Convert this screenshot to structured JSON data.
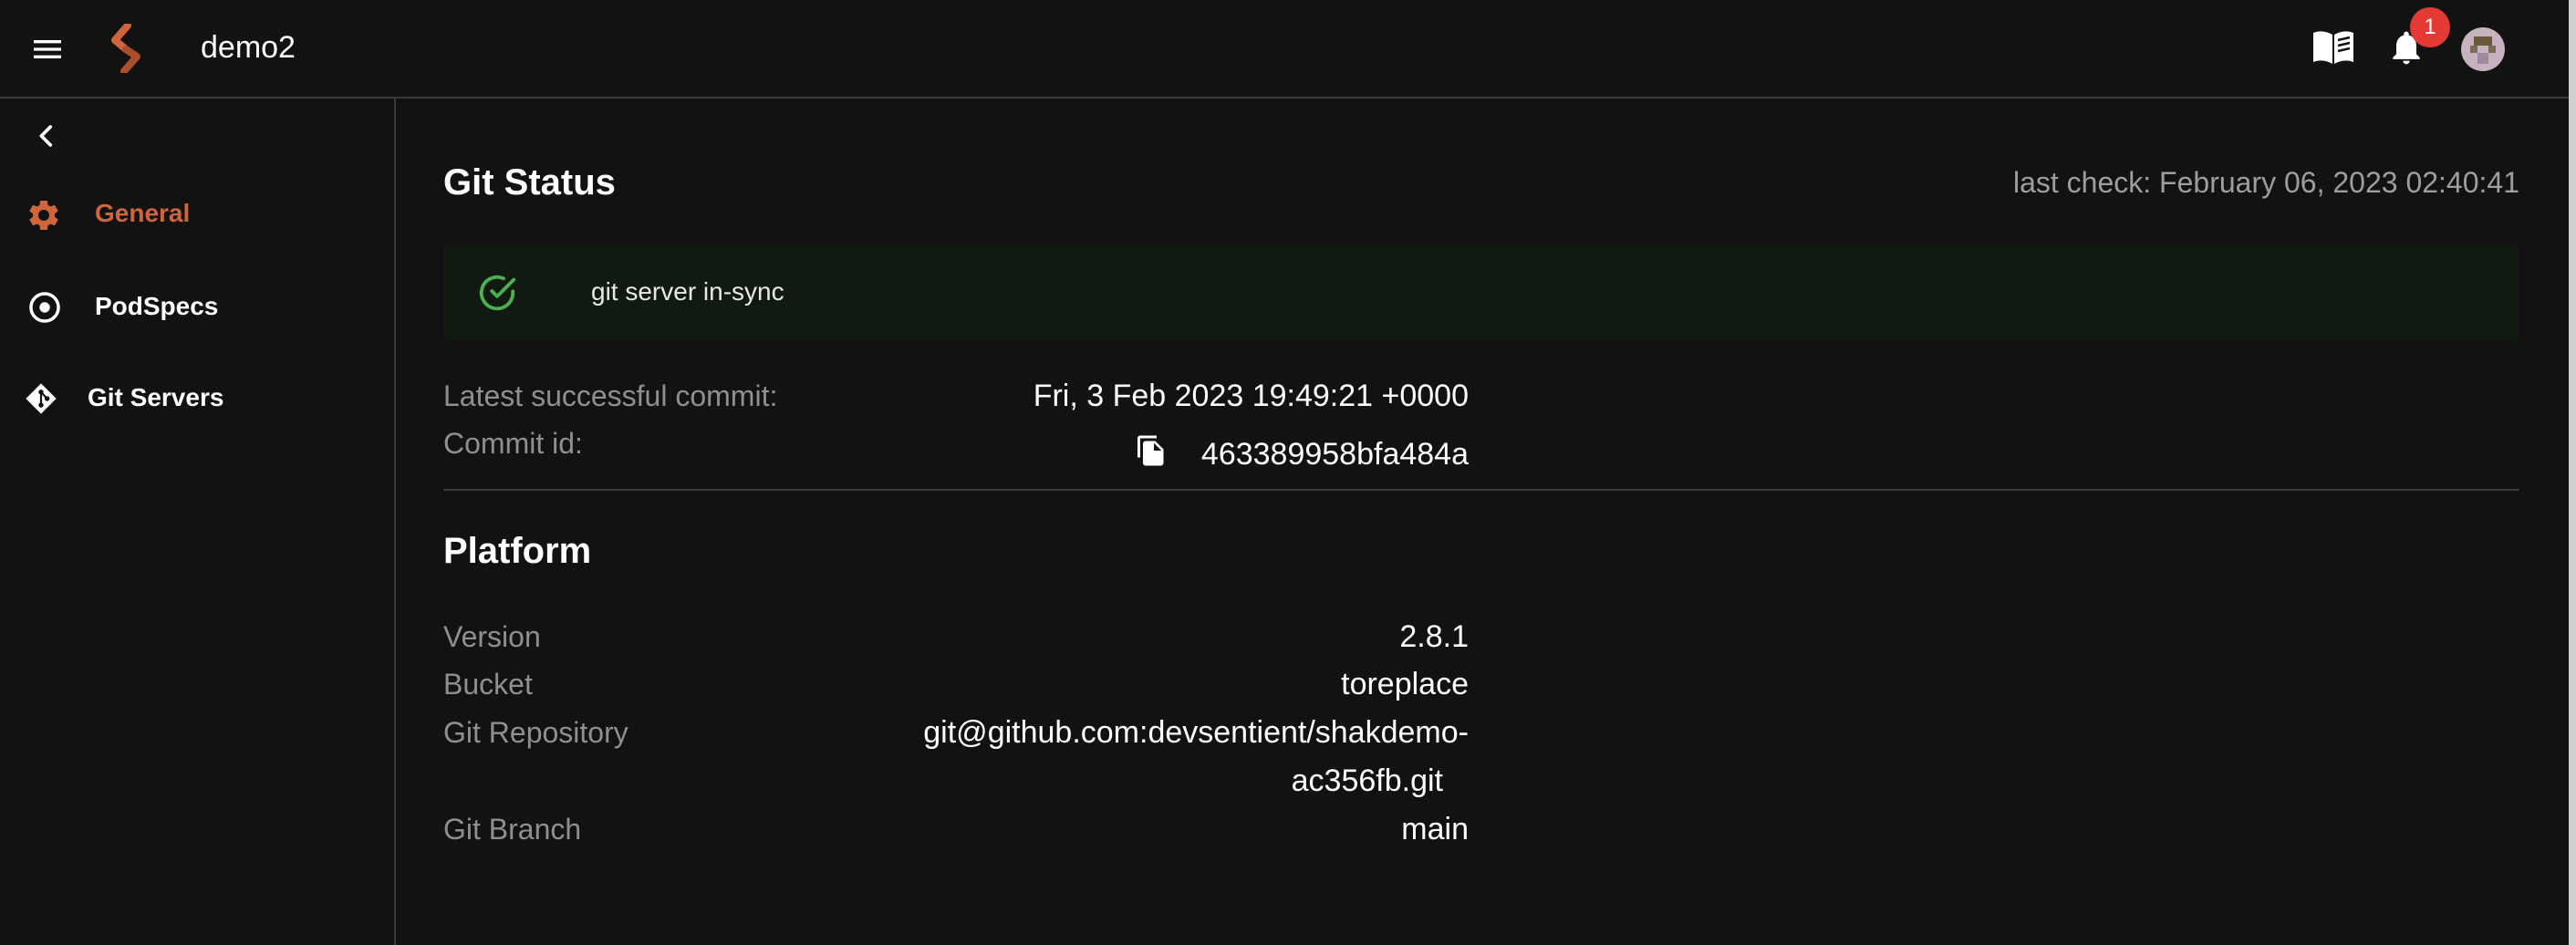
{
  "header": {
    "app_title": "demo2",
    "notifications_count": "1",
    "icons": [
      "menu-icon",
      "logo-icon",
      "docs-book-icon",
      "bell-icon",
      "avatar"
    ]
  },
  "sidebar": {
    "items": [
      {
        "label": "General",
        "icon": "gear-icon",
        "active": true
      },
      {
        "label": "PodSpecs",
        "icon": "target-icon",
        "active": false
      },
      {
        "label": "Git Servers",
        "icon": "git-icon",
        "active": false
      }
    ]
  },
  "git_status": {
    "title": "Git Status",
    "last_check": "last check: February 06, 2023 02:40:41",
    "alert": "git server in-sync",
    "latest_commit_label": "Latest successful commit:",
    "latest_commit_value": "Fri, 3 Feb 2023 19:49:21 +0000",
    "commit_id_label": "Commit id:",
    "commit_id_value": "463389958bfa484a"
  },
  "platform": {
    "title": "Platform",
    "version_label": "Version",
    "version_value": "2.8.1",
    "bucket_label": "Bucket",
    "bucket_value": "toreplace",
    "repo_label": "Git Repository",
    "repo_value_line1": "git@github.com:devsentient/shakdemo-",
    "repo_value_line2": "ac356fb.git",
    "branch_label": "Git Branch",
    "branch_value": "main"
  },
  "colors": {
    "background": "#121212",
    "accent": "#d0643a",
    "success": "#4caf50",
    "badge": "#e53935",
    "muted_text": "#8f8f8f"
  }
}
